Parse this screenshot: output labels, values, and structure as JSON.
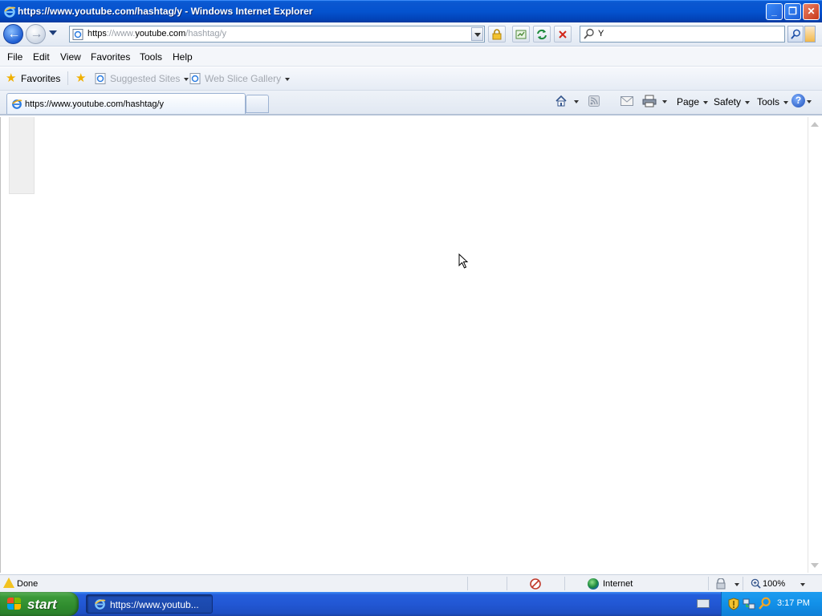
{
  "window": {
    "title": "https://www.youtube.com/hashtag/y - Windows Internet Explorer",
    "minimize_label": "_",
    "restore_label": "❐",
    "close_label": "✕"
  },
  "address_bar": {
    "url_scheme": "https",
    "url_sep": "://www.",
    "url_domain": "youtube.com",
    "url_path": "/hashtag/y",
    "back_glyph": "←",
    "forward_glyph": "→"
  },
  "search": {
    "query": "Y",
    "icon": "magnifier-icon"
  },
  "menu": [
    "File",
    "Edit",
    "View",
    "Favorites",
    "Tools",
    "Help"
  ],
  "favorites_bar": {
    "favorites_label": "Favorites",
    "suggested_sites": "Suggested Sites",
    "web_slice_gallery": "Web Slice Gallery"
  },
  "tabs": [
    {
      "label": "https://www.youtube.com/hashtag/y",
      "active": true
    }
  ],
  "command_bar": {
    "page": "Page",
    "safety": "Safety",
    "tools": "Tools",
    "help_glyph": "?"
  },
  "status_bar": {
    "status": "Done",
    "zone": "Internet",
    "zoom": "100%"
  },
  "taskbar": {
    "start_label": "start",
    "task_item": "https://www.youtub...",
    "clock": "3:17 PM"
  },
  "colors": {
    "title_bar": "#0453cf",
    "taskbar": "#245edb",
    "start_button": "#3c9a3a",
    "tray": "#1290e8"
  }
}
